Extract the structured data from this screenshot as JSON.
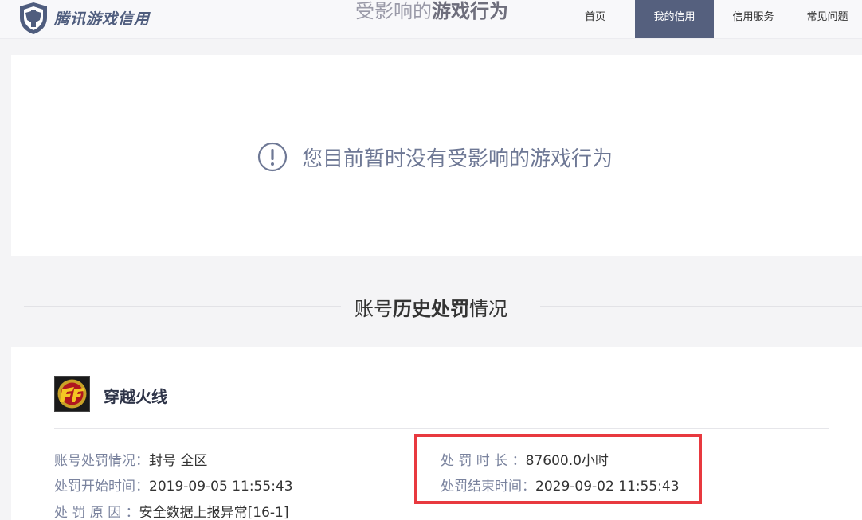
{
  "header": {
    "logo_text": "腾讯游戏信用",
    "title_normal": "受影响的",
    "title_bold": "游戏行为"
  },
  "nav": {
    "items": [
      {
        "label": "首页"
      },
      {
        "label": "我的信用"
      },
      {
        "label": "信用服务"
      },
      {
        "label": "常见问题"
      }
    ],
    "active_index": 1
  },
  "notice": {
    "text": "您目前暂时没有受影响的游戏行为"
  },
  "history_section": {
    "title_prefix": "账号",
    "title_bold": "历史处罚",
    "title_suffix": "情况"
  },
  "record": {
    "game_name": "穿越火线",
    "status_label": "账号处罚情况：",
    "status_value": "封号 全区",
    "start_label": "处罚开始时间：",
    "start_value": "2019-09-05 11:55:43",
    "reason_label": "处 罚 原 因 ：",
    "reason_value": "安全数据上报异常[16-1]",
    "duration_label": "处 罚 时 长 ：",
    "duration_value": "87600.0小时",
    "end_label": "处罚结束时间：",
    "end_value": "2029-09-02 11:55:43"
  },
  "colors": {
    "nav_active": "#55607e",
    "highlight_border": "#e8393f",
    "label_text": "#7a839e",
    "notice_text": "#6e7895"
  }
}
